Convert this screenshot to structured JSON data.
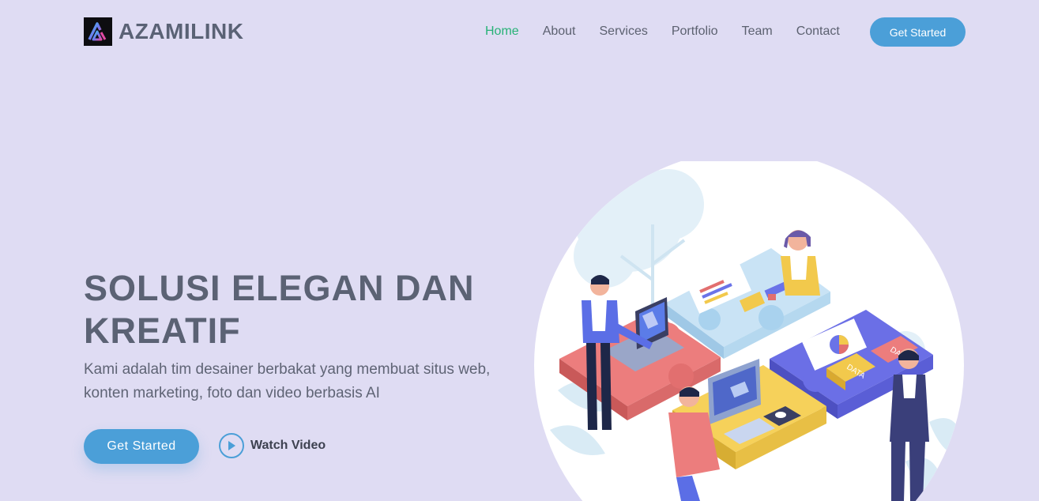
{
  "brand": {
    "name": "AZAMILINK"
  },
  "nav": {
    "items": [
      {
        "label": "Home",
        "active": true
      },
      {
        "label": "About",
        "active": false
      },
      {
        "label": "Services",
        "active": false
      },
      {
        "label": "Portfolio",
        "active": false
      },
      {
        "label": "Team",
        "active": false
      },
      {
        "label": "Contact",
        "active": false
      }
    ],
    "cta_label": "Get Started"
  },
  "hero": {
    "title_line1": "SOLUSI ELEGAN DAN",
    "title_line2": "KREATIF",
    "subtitle_line1": "Kami adalah tim desainer berbakat yang membuat situs web,",
    "subtitle_line2": "konten marketing, foto dan video berbasis AI",
    "cta_label": "Get Started",
    "watch_label": "Watch Video"
  },
  "illustration": {
    "piece_labels": [
      "DATA",
      "DATA"
    ]
  },
  "colors": {
    "background": "#dfdcf3",
    "accent": "#4b9fd8",
    "nav_active": "#27b276",
    "text": "#5b6274"
  }
}
